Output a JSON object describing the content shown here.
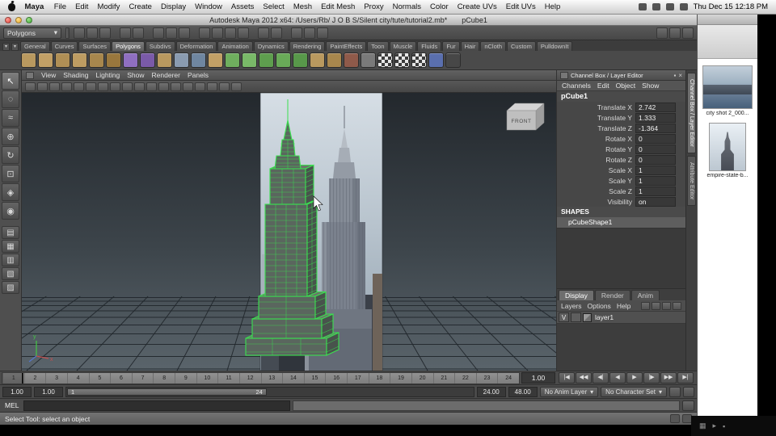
{
  "colors": {
    "selection_green": "#3ae04f",
    "viewport_top": "#23282d",
    "viewport_bottom": "#5a646b",
    "ui_gray": "#4a4a4a"
  },
  "macos": {
    "app_menu": "Maya",
    "menus": [
      "File",
      "Edit",
      "Modify",
      "Create",
      "Display",
      "Window",
      "Assets",
      "Select",
      "Mesh",
      "Edit Mesh",
      "Proxy",
      "Normals",
      "Color",
      "Create UVs",
      "Edit UVs",
      "Help"
    ],
    "status_icons": [
      {
        "name": "display-icon"
      },
      {
        "name": "bluetooth-icon"
      },
      {
        "name": "wifi-icon"
      },
      {
        "name": "battery-icon"
      }
    ],
    "clock": "Thu Dec 15 12:18 PM"
  },
  "window": {
    "title": "Autodesk Maya 2012 x64: /Users/Rb/ J O B S/Silent city/tute/tutorial2.mb*",
    "selection": "pCube1"
  },
  "statusline": {
    "mode": "Polygons",
    "dropdown_arrow": "▾",
    "icons": [
      {
        "name": "new-scene-icon"
      },
      {
        "name": "open-scene-icon"
      },
      {
        "name": "save-scene-icon"
      },
      {
        "name": "undo-icon",
        "cls": "sep"
      },
      {
        "name": "redo-icon"
      },
      {
        "name": "select-hierarchy-icon",
        "cls": "sep"
      },
      {
        "name": "select-object-icon"
      },
      {
        "name": "select-component-icon"
      },
      {
        "name": "snap-grid-icon",
        "cls": "sep"
      },
      {
        "name": "snap-curve-icon"
      },
      {
        "name": "snap-point-icon"
      },
      {
        "name": "snap-view-plane-icon"
      },
      {
        "name": "construction-history-icon",
        "cls": "sep"
      },
      {
        "name": "list-inputs-icon"
      },
      {
        "name": "render-current-frame-icon",
        "cls": "sep"
      },
      {
        "name": "ipr-render-icon"
      },
      {
        "name": "render-settings-icon"
      }
    ],
    "right_icons": [
      {
        "name": "show-grid-icon"
      },
      {
        "name": "sort-icon"
      },
      {
        "name": "hide-ui-icon"
      }
    ]
  },
  "shelf": {
    "arrow_glyph": "▾",
    "tabs": [
      {
        "label": "General"
      },
      {
        "label": "Curves"
      },
      {
        "label": "Surfaces"
      },
      {
        "label": "Polygons",
        "active": true
      },
      {
        "label": "Subdivs"
      },
      {
        "label": "Deformation"
      },
      {
        "label": "Animation"
      },
      {
        "label": "Dynamics"
      },
      {
        "label": "Rendering"
      },
      {
        "label": "PaintEffects"
      },
      {
        "label": "Toon"
      },
      {
        "label": "Muscle"
      },
      {
        "label": "Fluids"
      },
      {
        "label": "Fur"
      },
      {
        "label": "Hair"
      },
      {
        "label": "nCloth"
      },
      {
        "label": "Custom"
      },
      {
        "label": "PulldownIt"
      }
    ],
    "icons": [
      {
        "name": "poly-sphere-icon",
        "color": "#b9995f"
      },
      {
        "name": "poly-cube-icon",
        "color": "#c2a066"
      },
      {
        "name": "poly-cylinder-icon",
        "color": "#b08f55"
      },
      {
        "name": "poly-cone-icon",
        "color": "#bd9c62"
      },
      {
        "name": "poly-plane-icon",
        "color": "#a8874d"
      },
      {
        "name": "poly-torus-icon",
        "color": "#99773d"
      },
      {
        "name": "poly-prism-icon",
        "color": "#8f6fc0"
      },
      {
        "name": "poly-pyramid-icon",
        "color": "#7a5aa8"
      },
      {
        "name": "poly-pipe-icon",
        "color": "#b9995f"
      },
      {
        "name": "poly-helix-icon",
        "color": "#8a9bb0"
      },
      {
        "name": "poly-soccerball-icon",
        "color": "#6f86a0"
      },
      {
        "name": "platonic-solid-icon",
        "color": "#c2a066"
      },
      {
        "name": "smooth-icon",
        "color": "#6faf5e"
      },
      {
        "name": "subdivide-icon",
        "color": "#79b968"
      },
      {
        "name": "extrude-icon",
        "color": "#5e9e4e"
      },
      {
        "name": "bevel-icon",
        "color": "#69aa58"
      },
      {
        "name": "bridge-icon",
        "color": "#58984a"
      },
      {
        "name": "combine-icon",
        "color": "#b9995f"
      },
      {
        "name": "separate-icon",
        "color": "#a8874d"
      },
      {
        "name": "boolean-icon",
        "color": "#8f5a4a"
      },
      {
        "name": "mirror-geometry-icon",
        "color": "#7a7a7a"
      },
      {
        "name": "checker-map-icon",
        "cls": "checker"
      },
      {
        "name": "uv-checker-icon",
        "cls": "checker"
      },
      {
        "name": "texture-checker-icon",
        "cls": "checker"
      },
      {
        "name": "normal-map-icon",
        "color": "#5a6fae"
      },
      {
        "name": "color-set-icon",
        "color": "#474747"
      }
    ]
  },
  "toolbox": {
    "tools": [
      {
        "name": "select-tool",
        "glyph": "↖",
        "active": true
      },
      {
        "name": "lasso-select-tool",
        "glyph": "◌"
      },
      {
        "name": "paint-select-tool",
        "glyph": "≈"
      },
      {
        "name": "move-tool",
        "glyph": "⊕"
      },
      {
        "name": "rotate-tool",
        "glyph": "↻"
      },
      {
        "name": "scale-tool",
        "glyph": "⊡"
      },
      {
        "name": "universal-manipulator-tool",
        "glyph": "◈"
      },
      {
        "name": "soft-modification-tool",
        "glyph": "◉"
      }
    ],
    "layouts": [
      {
        "name": "single-pane-layout-button",
        "glyph": "▤"
      },
      {
        "name": "four-pane-layout-button",
        "glyph": "▦"
      },
      {
        "name": "two-pane-layout-button",
        "glyph": "▥"
      },
      {
        "name": "persp-outliner-layout-button",
        "glyph": "▧"
      },
      {
        "name": "hypershade-layout-button",
        "glyph": "▨"
      }
    ]
  },
  "viewport": {
    "menus": [
      "View",
      "Shading",
      "Lighting",
      "Show",
      "Renderer",
      "Panels"
    ],
    "toolbar_icons": [
      {
        "name": "camera-lock-icon"
      },
      {
        "name": "grid-toggle-icon"
      },
      {
        "name": "film-gate-icon"
      },
      {
        "name": "resolution-gate-icon"
      },
      {
        "name": "gate-mask-icon"
      },
      {
        "name": "field-chart-icon"
      },
      {
        "name": "safe-action-icon"
      },
      {
        "name": "safe-title-icon"
      },
      {
        "name": "wireframe-mode-icon"
      },
      {
        "name": "shaded-mode-icon"
      },
      {
        "name": "textured-mode-icon"
      },
      {
        "name": "use-all-lights-icon"
      },
      {
        "name": "shadows-icon"
      },
      {
        "name": "ambient-occlusion-icon"
      },
      {
        "name": "motion-blur-icon"
      },
      {
        "name": "multisample-icon"
      },
      {
        "name": "isolate-select-icon"
      },
      {
        "name": "xray-icon"
      }
    ],
    "view_label": "FRONT",
    "axis": {
      "x": "x",
      "y": "y",
      "z": "z"
    }
  },
  "channel_box": {
    "title": "Channel Box / Layer Editor",
    "title_icons": [
      "▪",
      "×"
    ],
    "menus": [
      "Channels",
      "Edit",
      "Object",
      "Show"
    ],
    "object": "pCube1",
    "attributes": [
      {
        "label": "Translate X",
        "value": "2.742"
      },
      {
        "label": "Translate Y",
        "value": "1.333"
      },
      {
        "label": "Translate Z",
        "value": "-1.364"
      },
      {
        "label": "Rotate X",
        "value": "0"
      },
      {
        "label": "Rotate Y",
        "value": "0"
      },
      {
        "label": "Rotate Z",
        "value": "0"
      },
      {
        "label": "Scale X",
        "value": "1"
      },
      {
        "label": "Scale Y",
        "value": "1"
      },
      {
        "label": "Scale Z",
        "value": "1"
      },
      {
        "label": "Visibility",
        "value": "on"
      }
    ],
    "shapes_header": "SHAPES",
    "shape_name": "pCubeShape1",
    "side_tabs": [
      {
        "label": "Channel Box / Layer Editor",
        "active": true
      },
      {
        "label": "Attribute Editor"
      }
    ]
  },
  "layer_editor": {
    "tabs": [
      {
        "label": "Display",
        "active": true
      },
      {
        "label": "Render"
      },
      {
        "label": "Anim"
      }
    ],
    "menus": [
      "Layers",
      "Options",
      "Help"
    ],
    "icons": [
      {
        "name": "new-empty-layer-icon"
      },
      {
        "name": "new-layer-from-selected-icon"
      },
      {
        "name": "move-layer-up-icon"
      },
      {
        "name": "move-layer-down-icon"
      }
    ],
    "layer": {
      "visibility": "V",
      "type": "",
      "name": "layer1"
    }
  },
  "timeline": {
    "ticks": [
      "1",
      "2",
      "3",
      "4",
      "5",
      "6",
      "7",
      "8",
      "9",
      "10",
      "11",
      "12",
      "13",
      "14",
      "15",
      "16",
      "17",
      "18",
      "19",
      "20",
      "21",
      "22",
      "23",
      "24"
    ],
    "current_frame": "1.00",
    "playback": [
      {
        "label": "|◀",
        "name": "go-to-start-button"
      },
      {
        "label": "◀◀",
        "name": "step-back-frame-button"
      },
      {
        "label": "◀|",
        "name": "step-back-key-button"
      },
      {
        "label": "◀",
        "name": "play-backwards-button"
      },
      {
        "label": "▶",
        "name": "play-forwards-button"
      },
      {
        "label": "|▶",
        "name": "step-forward-key-button"
      },
      {
        "label": "▶▶",
        "name": "step-forward-frame-button"
      },
      {
        "label": "▶|",
        "name": "go-to-end-button"
      }
    ]
  },
  "range": {
    "anim_start": "1.00",
    "playback_start": "1.00",
    "handle_start": "1",
    "handle_end": "24",
    "playback_end": "24.00",
    "anim_end": "48.00",
    "anim_layer": "No Anim Layer",
    "character_set": "No Character Set",
    "dropdown_arrow": "▾"
  },
  "command_line": {
    "label": "MEL"
  },
  "help_line": {
    "text": "Select Tool: select an object"
  },
  "finder": {
    "items": [
      {
        "label": "city shot 2_000...",
        "cls": "thumb-city",
        "name": "finder-item-city-shot"
      },
      {
        "label": "empire-state-b...",
        "cls": "thumb-esb",
        "name": "finder-item-empire-state"
      }
    ]
  },
  "bottom_bar": {
    "icons": [
      {
        "glyph": "▦",
        "name": "grid-view-icon"
      },
      {
        "glyph": "▸",
        "name": "play-icon"
      },
      {
        "glyph": "▪",
        "name": "stop-icon"
      }
    ]
  }
}
